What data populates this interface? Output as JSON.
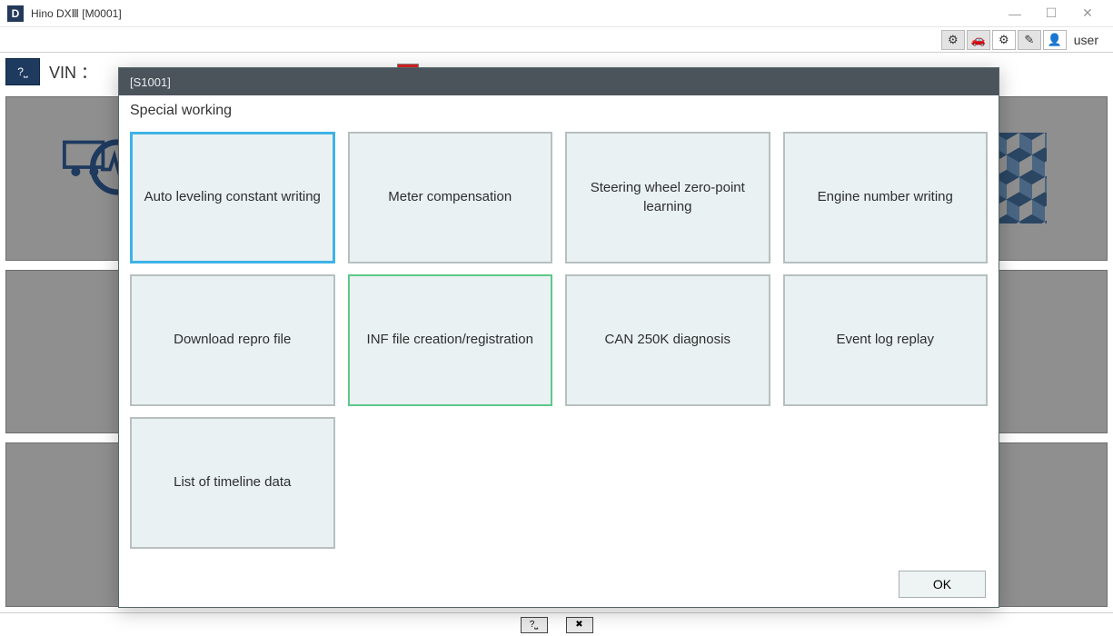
{
  "window": {
    "app_icon_letter": "D",
    "title": "Hino DXⅢ [M0001]"
  },
  "toolbar": {
    "user_label": "user"
  },
  "vin": {
    "label": "VIN ："
  },
  "modal": {
    "code": "[S1001]",
    "subtitle": "Special working",
    "options": [
      "Auto leveling constant writing",
      "Meter compensation",
      "Steering wheel zero-point learning",
      "Engine number writing",
      "Download repro file",
      "INF file creation/registration",
      "CAN 250K diagnosis",
      "Event log replay",
      "List of timeline data"
    ],
    "selected_index": 0,
    "highlight_index": 5,
    "ok_label": "OK"
  }
}
